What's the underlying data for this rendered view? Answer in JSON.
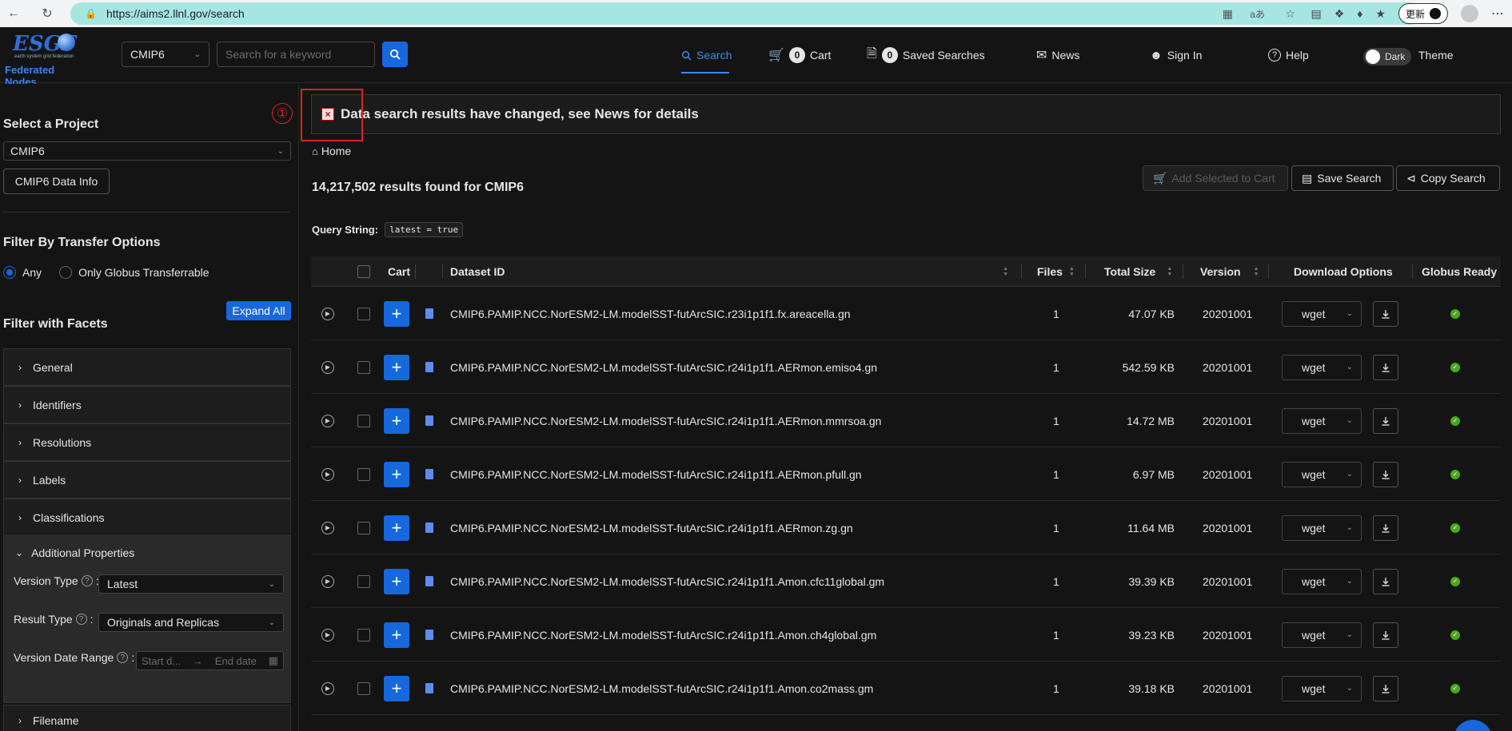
{
  "browser": {
    "url": "https://aims2.llnl.gov/search",
    "update_label": "更新",
    "translate_glyph": "aあ"
  },
  "header": {
    "logo_title": "ESGF",
    "logo_subtitle": "earth system grid federation",
    "logo_nodes": "Federated Nodes",
    "project_value": "CMIP6",
    "search_placeholder": "Search for a keyword",
    "nav": {
      "search": "Search",
      "cart_count": "0",
      "cart": "Cart",
      "saved_count": "0",
      "saved": "Saved Searches",
      "news": "News",
      "signin": "Sign In",
      "help": "Help",
      "toggle": "Dark",
      "theme": "Theme"
    }
  },
  "sidebar": {
    "select_project_heading": "Select a Project",
    "project_value": "CMIP6",
    "data_info_button": "CMIP6 Data Info",
    "transfer_heading": "Filter By Transfer Options",
    "radio_any": "Any",
    "radio_globus": "Only Globus Transferrable",
    "facets_heading": "Filter with Facets",
    "expand_all": "Expand All",
    "facets": [
      "General",
      "Identifiers",
      "Resolutions",
      "Labels",
      "Classifications"
    ],
    "additional_properties": "Additional Properties",
    "version_type_label": "Version Type",
    "version_type_value": "Latest",
    "result_type_label": "Result Type",
    "result_type_value": "Originals and Replicas",
    "version_date_label": "Version Date Range",
    "start_placeholder": "Start d...",
    "end_placeholder": "End date",
    "filename": "Filename"
  },
  "main": {
    "banner": "Data search results have changed, see News for details",
    "annotation_number": "①",
    "home": "Home",
    "results": "14,217,502 results found for CMIP6",
    "add_to_cart": "Add Selected to Cart",
    "save_search": "Save Search",
    "copy_search": "Copy Search",
    "query_label": "Query String:",
    "query_value": "latest = true"
  },
  "table": {
    "headers": {
      "cart": "Cart",
      "dataset_id": "Dataset ID",
      "files": "Files",
      "size": "Total Size",
      "version": "Version",
      "download": "Download Options",
      "globus": "Globus Ready"
    },
    "rows": [
      {
        "id": "CMIP6.PAMIP.NCC.NorESM2-LM.modelSST-futArcSIC.r23i1p1f1.fx.areacella.gn",
        "files": "1",
        "size": "47.07 KB",
        "version": "20201001",
        "download": "wget"
      },
      {
        "id": "CMIP6.PAMIP.NCC.NorESM2-LM.modelSST-futArcSIC.r24i1p1f1.AERmon.emiso4.gn",
        "files": "1",
        "size": "542.59 KB",
        "version": "20201001",
        "download": "wget"
      },
      {
        "id": "CMIP6.PAMIP.NCC.NorESM2-LM.modelSST-futArcSIC.r24i1p1f1.AERmon.mmrsoa.gn",
        "files": "1",
        "size": "14.72 MB",
        "version": "20201001",
        "download": "wget"
      },
      {
        "id": "CMIP6.PAMIP.NCC.NorESM2-LM.modelSST-futArcSIC.r24i1p1f1.AERmon.pfull.gn",
        "files": "1",
        "size": "6.97 MB",
        "version": "20201001",
        "download": "wget"
      },
      {
        "id": "CMIP6.PAMIP.NCC.NorESM2-LM.modelSST-futArcSIC.r24i1p1f1.AERmon.zg.gn",
        "files": "1",
        "size": "11.64 MB",
        "version": "20201001",
        "download": "wget"
      },
      {
        "id": "CMIP6.PAMIP.NCC.NorESM2-LM.modelSST-futArcSIC.r24i1p1f1.Amon.cfc11global.gm",
        "files": "1",
        "size": "39.39 KB",
        "version": "20201001",
        "download": "wget"
      },
      {
        "id": "CMIP6.PAMIP.NCC.NorESM2-LM.modelSST-futArcSIC.r24i1p1f1.Amon.ch4global.gm",
        "files": "1",
        "size": "39.23 KB",
        "version": "20201001",
        "download": "wget"
      },
      {
        "id": "CMIP6.PAMIP.NCC.NorESM2-LM.modelSST-futArcSIC.r24i1p1f1.Amon.co2mass.gm",
        "files": "1",
        "size": "39.18 KB",
        "version": "20201001",
        "download": "wget"
      }
    ]
  },
  "colors": {
    "accent": "#1668dc",
    "annotation": "#e02020",
    "success": "#49aa19",
    "url_bar": "#a5e6e1"
  }
}
